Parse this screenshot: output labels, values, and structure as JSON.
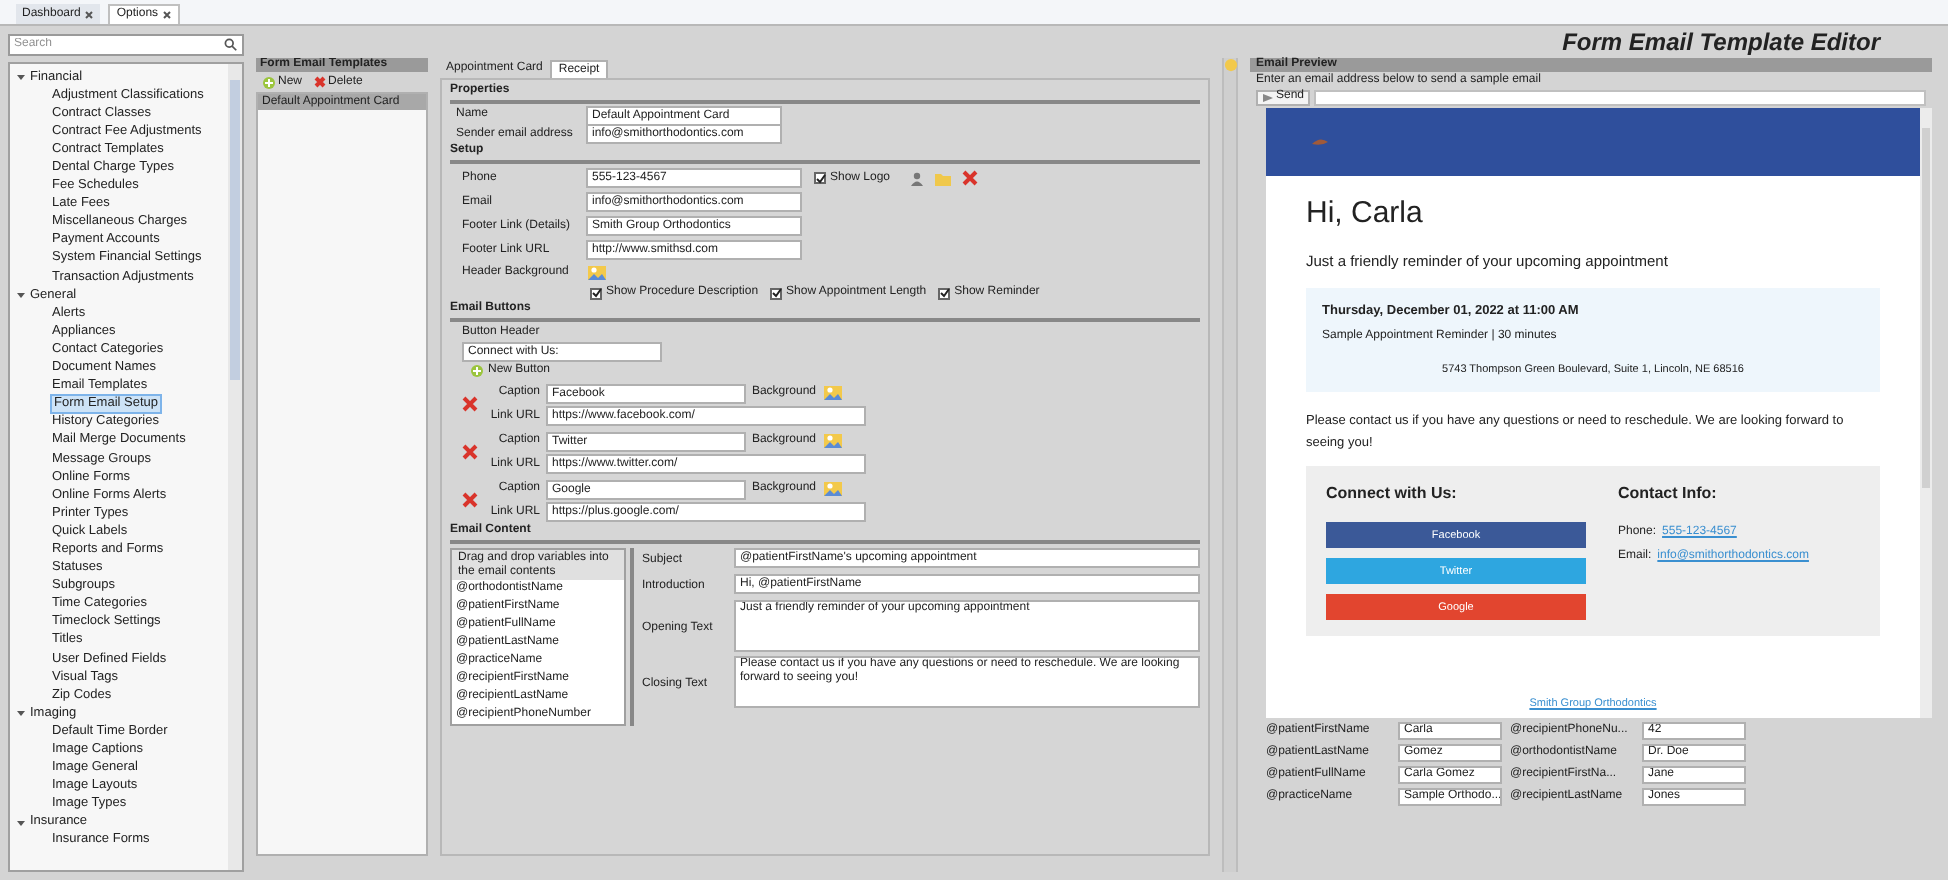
{
  "tabs": [
    {
      "label": "Dashboard",
      "selected": false
    },
    {
      "label": "Options",
      "selected": true
    }
  ],
  "title": "Form Email Template Editor",
  "search": {
    "placeholder": "Search"
  },
  "tree": [
    {
      "label": "Financial",
      "expanded": true,
      "children": [
        {
          "label": "Adjustment Classifications",
          "selected": false
        },
        {
          "label": "Contract Classes",
          "selected": false
        },
        {
          "label": "Contract Fee Adjustments",
          "selected": false
        },
        {
          "label": "Contract Templates",
          "selected": false
        },
        {
          "label": "Dental Charge Types",
          "selected": false
        },
        {
          "label": "Fee Schedules",
          "selected": false
        },
        {
          "label": "Late Fees",
          "selected": false
        },
        {
          "label": "Miscellaneous Charges",
          "selected": false
        },
        {
          "label": "Payment Accounts",
          "selected": false
        },
        {
          "label": "System Financial Settings",
          "selected": false
        },
        {
          "label": "Transaction Adjustments",
          "selected": false
        }
      ]
    },
    {
      "label": "General",
      "expanded": true,
      "children": [
        {
          "label": "Alerts",
          "selected": false
        },
        {
          "label": "Appliances",
          "selected": false
        },
        {
          "label": "Contact Categories",
          "selected": false
        },
        {
          "label": "Document Names",
          "selected": false
        },
        {
          "label": "Email Templates",
          "selected": false
        },
        {
          "label": "Form Email Setup",
          "selected": true
        },
        {
          "label": "History Categories",
          "selected": false
        },
        {
          "label": "Mail Merge Documents",
          "selected": false
        },
        {
          "label": "Message Groups",
          "selected": false
        },
        {
          "label": "Online Forms",
          "selected": false
        },
        {
          "label": "Online Forms Alerts",
          "selected": false
        },
        {
          "label": "Printer Types",
          "selected": false
        },
        {
          "label": "Quick Labels",
          "selected": false
        },
        {
          "label": "Reports and Forms",
          "selected": false
        },
        {
          "label": "Statuses",
          "selected": false
        },
        {
          "label": "Subgroups",
          "selected": false
        },
        {
          "label": "Time Categories",
          "selected": false
        },
        {
          "label": "Timeclock Settings",
          "selected": false
        },
        {
          "label": "Titles",
          "selected": false
        },
        {
          "label": "User Defined Fields",
          "selected": false
        },
        {
          "label": "Visual Tags",
          "selected": false
        },
        {
          "label": "Zip Codes",
          "selected": false
        }
      ]
    },
    {
      "label": "Imaging",
      "expanded": true,
      "children": [
        {
          "label": "Default Time Border",
          "selected": false
        },
        {
          "label": "Image Captions",
          "selected": false
        },
        {
          "label": "Image General",
          "selected": false
        },
        {
          "label": "Image Layouts",
          "selected": false
        },
        {
          "label": "Image Types",
          "selected": false
        }
      ]
    },
    {
      "label": "Insurance",
      "expanded": true,
      "children": [
        {
          "label": "Insurance Forms",
          "selected": false
        }
      ]
    }
  ],
  "templates": {
    "title": "Form Email Templates",
    "new_label": "New",
    "delete_label": "Delete",
    "items": [
      {
        "label": "Default Appointment Card",
        "selected": true
      }
    ]
  },
  "editor": {
    "tabs": [
      {
        "label": "Appointment Card",
        "selected": false
      },
      {
        "label": "Receipt",
        "selected": true
      }
    ],
    "properties": {
      "title": "Properties",
      "fields": [
        {
          "label": "Name",
          "value": "Default Appointment Card"
        },
        {
          "label": "Sender email address",
          "value": "info@smithorthodontics.com"
        }
      ]
    },
    "setup": {
      "title": "Setup",
      "fields": [
        {
          "label": "Phone",
          "value": "555-123-4567"
        },
        {
          "label": "Email",
          "value": "info@smithorthodontics.com"
        },
        {
          "label": "Footer Link (Details)",
          "value": "Smith Group Orthodontics"
        },
        {
          "label": "Footer Link URL",
          "value": "http://www.smithsd.com"
        }
      ],
      "show_logo": {
        "label": "Show Logo",
        "checked": true
      },
      "header_background": "Header Background",
      "options": [
        {
          "label": "Show Procedure Description",
          "checked": true
        },
        {
          "label": "Show Appointment Length",
          "checked": true
        },
        {
          "label": "Show Reminder",
          "checked": true
        }
      ]
    },
    "buttons": {
      "title": "Email Buttons",
      "header_label": "Button Header",
      "header_value": "Connect with Us:",
      "new_label": "New Button",
      "items": [
        {
          "caption_label": "Caption",
          "caption": "Facebook",
          "link_label": "Link URL",
          "link": "https://www.facebook.com/",
          "background_label": "Background"
        },
        {
          "caption_label": "Caption",
          "caption": "Twitter",
          "link_label": "Link URL",
          "link": "https://www.twitter.com/",
          "background_label": "Background"
        },
        {
          "caption_label": "Caption",
          "caption": "Google",
          "link_label": "Link URL",
          "link": "https://plus.google.com/",
          "background_label": "Background"
        }
      ]
    },
    "content": {
      "title": "Email Content",
      "hint": "Drag and drop variables into the email contents",
      "variables": [
        "@orthodontistName",
        "@patientFirstName",
        "@patientFullName",
        "@patientLastName",
        "@practiceName",
        "@recipientFirstName",
        "@recipientLastName",
        "@recipientPhoneNumber"
      ],
      "fields": [
        {
          "label": "Subject",
          "value": "@patientFirstName's upcoming appointment",
          "kind": "line"
        },
        {
          "label": "Introduction",
          "value": "Hi, @patientFirstName",
          "kind": "line"
        },
        {
          "label": "Opening Text",
          "value": "Just a friendly reminder of your upcoming appointment",
          "kind": "area"
        },
        {
          "label": "Closing Text",
          "value": "Please contact us if you have any questions or need to reschedule.  We are looking forward to seeing you!",
          "kind": "area"
        }
      ]
    }
  },
  "preview": {
    "title": "Email Preview",
    "instruction": "Enter an email address below to send a sample email",
    "send_label": "Send",
    "greeting": "Hi, Carla",
    "intro": "Just a friendly reminder of your upcoming appointment",
    "appointment": {
      "when": "Thursday, December 01, 2022 at 11:00 AM",
      "what": "Sample Appointment Reminder | 30 minutes",
      "where": "5743 Thompson Green Boulevard, Suite 1, Lincoln, NE 68516"
    },
    "closing": "Please contact us if you have any questions or need to reschedule.  We are looking forward to seeing you!",
    "connect_title": "Connect with Us:",
    "buttons": [
      {
        "label": "Facebook",
        "color": "#3b5998"
      },
      {
        "label": "Twitter",
        "color": "#2ea6e0"
      },
      {
        "label": "Google",
        "color": "#e2452f"
      }
    ],
    "contact_title": "Contact Info:",
    "contact": [
      {
        "label": "Phone:",
        "value": "555-123-4567"
      },
      {
        "label": "Email:",
        "value": "info@smithorthodontics.com"
      }
    ],
    "footer_link": "Smith Group Orthodontics"
  },
  "variables": [
    {
      "name": "@patientFirstName",
      "value": "Carla"
    },
    {
      "name": "@patientLastName",
      "value": "Gomez"
    },
    {
      "name": "@patientFullName",
      "value": "Carla Gomez"
    },
    {
      "name": "@practiceName",
      "value": "Sample Orthodo..."
    },
    {
      "name": "@recipientPhoneNu...",
      "value": "42"
    },
    {
      "name": "@orthodontistName",
      "value": "Dr. Doe"
    },
    {
      "name": "@recipientFirstNa...",
      "value": "Jane"
    },
    {
      "name": "@recipientLastName",
      "value": "Jones"
    }
  ]
}
